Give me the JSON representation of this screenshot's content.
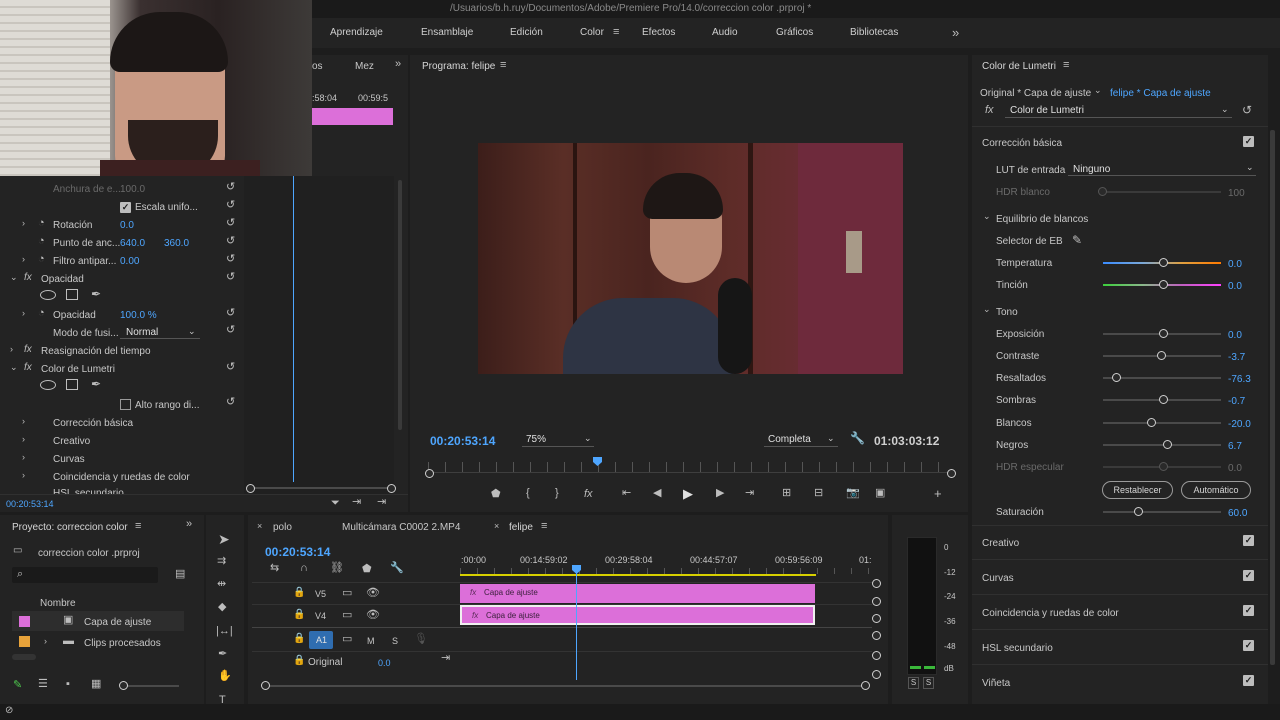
{
  "window": {
    "path": "/Usuarios/b.h.ruy/Documentos/Adobe/Premiere Pro/14.0/correccion color .prproj *"
  },
  "workspaces": [
    "Aprendizaje",
    "Ensamblaje",
    "Edición",
    "Color",
    "Efectos",
    "Audio",
    "Gráficos",
    "Bibliotecas"
  ],
  "source_panel": {
    "tab_partial": "os",
    "tab": "Mez",
    "tc_left": ":58:04",
    "tc_right": "00:59:5"
  },
  "effect_controls": {
    "rows": {
      "anchura_label": "Anchura de e...",
      "anchura_val": "100.0",
      "escala_label": "Escala unifo...",
      "rotacion_label": "Rotación",
      "rotacion_val": "0.0",
      "punto_label": "Punto de anc...",
      "punto_x": "640.0",
      "punto_y": "360.0",
      "filtro_label": "Filtro antipar...",
      "filtro_val": "0.00",
      "opacidad_fx": "Opacidad",
      "opacidad_label": "Opacidad",
      "opacidad_val": "100.0 %",
      "modo_label": "Modo de fusi...",
      "modo_val": "Normal",
      "reasig": "Reasignación del tiempo",
      "lumetri": "Color de Lumetri",
      "alto_rango": "Alto rango di...",
      "correccion": "Corrección básica",
      "creativo": "Creativo",
      "curvas": "Curvas",
      "coincidencia": "Coincidencia y ruedas de color",
      "hsl": "HSL secundario"
    },
    "timecode": "00:20:53:14"
  },
  "program": {
    "title": "Programa: felipe",
    "timecode": "00:20:53:14",
    "zoom": "75%",
    "quality": "Completa",
    "duration": "01:03:03:12"
  },
  "lumetri": {
    "title": "Color de Lumetri",
    "source_original": "Original * Capa de ajuste",
    "source_target": "felipe * Capa de ajuste",
    "fx_select": "Color de Lumetri",
    "basic": "Corrección básica",
    "lut_label": "LUT de entrada",
    "lut_value": "Ninguno",
    "hdr_blanco": "HDR blanco",
    "hdr_blanco_val": "100",
    "eq_blancos": "Equilibrio de blancos",
    "selector": "Selector de EB",
    "temperatura": "Temperatura",
    "temperatura_val": "0.0",
    "tincion": "Tinción",
    "tincion_val": "0.0",
    "tono": "Tono",
    "exposicion": "Exposición",
    "exposicion_val": "0.0",
    "contraste": "Contraste",
    "contraste_val": "-3.7",
    "resaltados": "Resaltados",
    "resaltados_val": "-76.3",
    "sombras": "Sombras",
    "sombras_val": "-0.7",
    "blancos": "Blancos",
    "blancos_val": "-20.0",
    "negros": "Negros",
    "negros_val": "6.7",
    "hdr_especular": "HDR especular",
    "hdr_especular_val": "0.0",
    "restablecer": "Restablecer",
    "automatico": "Automático",
    "saturacion": "Saturación",
    "saturacion_val": "60.0",
    "sections": [
      "Creativo",
      "Curvas",
      "Coincidencia y ruedas de color",
      "HSL secundario",
      "Viñeta"
    ]
  },
  "project": {
    "title": "Proyecto: correccion color",
    "file": "correccion color .prproj",
    "col_name": "Nombre",
    "items": [
      "Capa de ajuste",
      "Clips procesados"
    ]
  },
  "timeline": {
    "tabs": [
      "polo",
      "Multicámara C0002 2.MP4",
      "felipe"
    ],
    "timecode": "00:20:53:14",
    "ruler": [
      ":00:00",
      "00:14:59:02",
      "00:29:58:04",
      "00:44:57:07",
      "00:59:56:09",
      "01:"
    ],
    "tracks": {
      "v5": "V5",
      "v4": "V4",
      "a1": "A1",
      "m": "M",
      "s": "S",
      "original": "Original",
      "original_val": "0.0"
    },
    "clip_label": "Capa de ajuste"
  },
  "meter": {
    "ticks": [
      "0",
      "-12",
      "-24",
      "-36",
      "-48",
      "dB"
    ],
    "solo": [
      "S",
      "S"
    ]
  }
}
